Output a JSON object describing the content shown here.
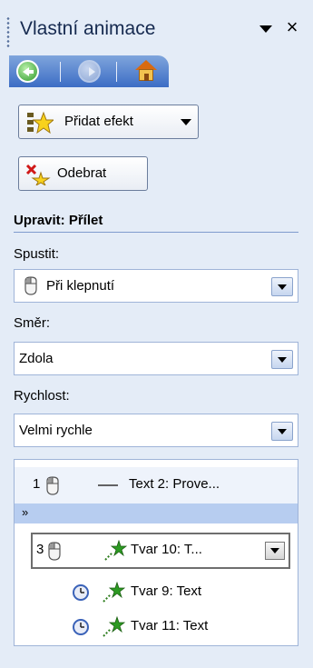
{
  "panel": {
    "title": "Vlastní animace",
    "close_glyph": "×"
  },
  "toolbar": {
    "add_effect_label": "Přidat efekt",
    "remove_label": "Odebrat"
  },
  "edit_section": {
    "title": "Upravit: Přílet",
    "start": {
      "label": "Spustit:",
      "value": "Při klepnutí"
    },
    "direction": {
      "label": "Směr:",
      "value": "Zdola"
    },
    "speed": {
      "label": "Rychlost:",
      "value": "Velmi rychle"
    }
  },
  "animation_list": [
    {
      "number": "1",
      "text": "Text 2: Prove...",
      "trigger_icon": "mouse-icon",
      "effect_icon": "line-icon"
    },
    {
      "number": "3",
      "text": "Tvar 10: T...",
      "trigger_icon": "mouse-icon",
      "effect_icon": "green-star-icon"
    },
    {
      "number": "",
      "text": "Tvar 9: Text",
      "trigger_icon": "clock-icon",
      "effect_icon": "green-star-icon"
    },
    {
      "number": "",
      "text": "Tvar 11: Text",
      "trigger_icon": "clock-icon",
      "effect_icon": "green-star-icon"
    }
  ],
  "colors": {
    "panel_bg": "#e4ecf7",
    "nav_strip": "#3c6dc5",
    "title_text": "#15294f",
    "collapse_bar": "#b7cdf0",
    "section_rule": "#7f9bcd"
  }
}
